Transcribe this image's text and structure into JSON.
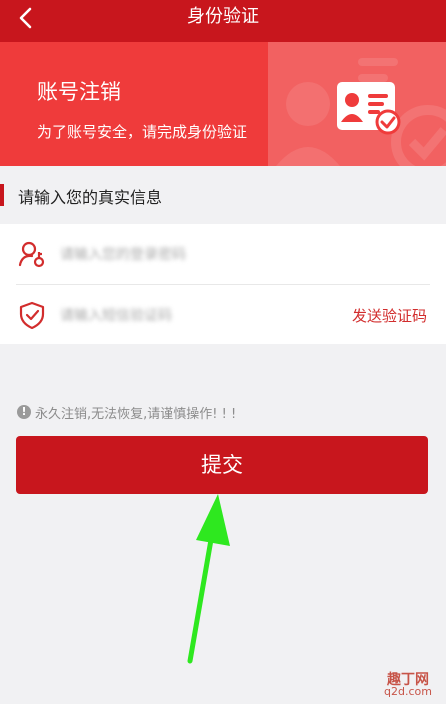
{
  "header": {
    "title": "身份验证",
    "back_icon": "chevron-left-icon"
  },
  "banner": {
    "title": "账号注销",
    "subtitle": "为了账号安全，请完成身份验证",
    "illustration_icon": "id-card-check-icon"
  },
  "section": {
    "title": "请输入您的真实信息"
  },
  "form": {
    "password_placeholder": "请输入您的登录密码",
    "password_value": "",
    "password_icon": "user-key-icon",
    "code_placeholder": "请输入短信验证码",
    "code_value": "",
    "code_icon": "shield-check-icon",
    "send_code_label": "发送验证码"
  },
  "warning": {
    "icon": "exclamation-circle-icon",
    "text": "永久注销,无法恢复,请谨慎操作! ! !"
  },
  "submit": {
    "label": "提交"
  },
  "annotation": {
    "arrow_color": "#2ee81f"
  },
  "watermark": {
    "line1": "趣丁网",
    "line2": "q2d.com"
  },
  "colors": {
    "primary": "#c8161d",
    "banner": "#ef3b3b",
    "accent_text": "#d22d2d"
  }
}
